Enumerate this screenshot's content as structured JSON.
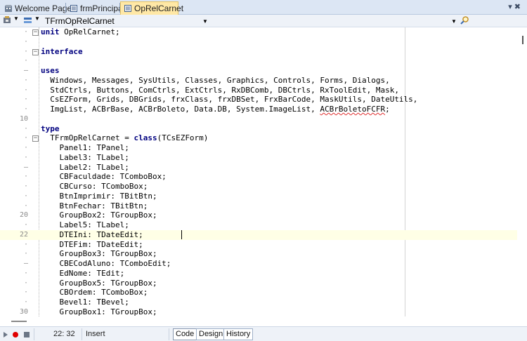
{
  "tabs": [
    {
      "label": "Welcome Page",
      "icon": "welcome-page-icon",
      "active": false
    },
    {
      "label": "frmPrincipal",
      "icon": "unit-file-icon",
      "active": false
    },
    {
      "label": "OpRelCarnet",
      "icon": "unit-file-icon",
      "active": true
    }
  ],
  "window_controls": {
    "dropdown_icon": "tab-list-chevron-icon",
    "close_icon": "close-icon"
  },
  "toolbar": {
    "class_combo_value": "TFrmOpRelCarnet",
    "method_combo_value": "",
    "search_icon": "search-icon"
  },
  "editor": {
    "current_line": 22,
    "lines": [
      {
        "num": "",
        "fold": "minus",
        "html": "<span class='kw'>unit</span> OpRelCarnet;"
      },
      {
        "num": "",
        "fold": "",
        "html": ""
      },
      {
        "num": "",
        "fold": "minus",
        "html": "<span class='kw'>interface</span>"
      },
      {
        "num": "",
        "fold": "",
        "html": ""
      },
      {
        "num": "–",
        "fold": "",
        "html": "<span class='kw'>uses</span>"
      },
      {
        "num": "",
        "fold": "",
        "html": "  Windows, Messages, SysUtils, Classes, Graphics, Controls, Forms, Dialogs,"
      },
      {
        "num": "",
        "fold": "",
        "html": "  StdCtrls, Buttons, ComCtrls, ExtCtrls, RxDBComb, DBCtrls, RxToolEdit, Mask,"
      },
      {
        "num": "",
        "fold": "",
        "html": "  CsEZForm, Grids, DBGrids, frxClass, frxDBSet, FrxBarCode, MaskUtils, DateUtils,"
      },
      {
        "num": "",
        "fold": "",
        "html": "  ImgList, ACBrBase, ACBrBoleto, Data.DB, System.ImageList, <span class='squig'>ACBrBoletoFCFR</span>;"
      },
      {
        "num": "10",
        "fold": "",
        "html": ""
      },
      {
        "num": "",
        "fold": "",
        "html": "<span class='kw'>type</span>"
      },
      {
        "num": "",
        "fold": "minus",
        "html": "  TFrmOpRelCarnet = <span class='kw'>class</span>(TCsEZForm)"
      },
      {
        "num": "",
        "fold": "",
        "html": "    Panel1: TPanel;"
      },
      {
        "num": "",
        "fold": "",
        "html": "    Label3: TLabel;"
      },
      {
        "num": "–",
        "fold": "",
        "html": "    Label2: TLabel;"
      },
      {
        "num": "",
        "fold": "",
        "html": "    CBFaculdade: TComboBox;"
      },
      {
        "num": "",
        "fold": "",
        "html": "    CBCurso: TComboBox;"
      },
      {
        "num": "",
        "fold": "",
        "html": "    BtnImprimir: TBitBtn;"
      },
      {
        "num": "",
        "fold": "",
        "html": "    BtnFechar: TBitBtn;"
      },
      {
        "num": "20",
        "fold": "",
        "html": "    GroupBox2: TGroupBox;"
      },
      {
        "num": "",
        "fold": "",
        "html": "    Label5: TLabel;"
      },
      {
        "num": "22",
        "fold": "",
        "html": "    DTEIni: TDateEdit;"
      },
      {
        "num": "",
        "fold": "",
        "html": "    DTEFim: TDateEdit;"
      },
      {
        "num": "",
        "fold": "",
        "html": "    GroupBox3: TGroupBox;"
      },
      {
        "num": "–",
        "fold": "",
        "html": "    CBECodAluno: TComboEdit;"
      },
      {
        "num": "",
        "fold": "",
        "html": "    EdNome: TEdit;"
      },
      {
        "num": "",
        "fold": "",
        "html": "    GroupBox5: TGroupBox;"
      },
      {
        "num": "",
        "fold": "",
        "html": "    CBOrdem: TComboBox;"
      },
      {
        "num": "",
        "fold": "",
        "html": "    Bevel1: TBevel;"
      },
      {
        "num": "30",
        "fold": "",
        "html": "    GroupBox1: TGroupBox;"
      }
    ]
  },
  "status": {
    "position": "22: 32",
    "mode": "Insert",
    "record_icon": "record-macro-icon",
    "play_icon": "play-macro-icon",
    "stop_icon": "stop-macro-icon"
  },
  "view_tabs": [
    {
      "label": "Code",
      "active": true
    },
    {
      "label": "Design",
      "active": false
    },
    {
      "label": "History",
      "active": false
    }
  ],
  "colors": {
    "keyword": "#00007f",
    "active_tab": "#ffe8a6",
    "current_line_bg": "#ffffe6",
    "tabbar_bg": "#dce6f4",
    "record_red": "#e00000"
  }
}
